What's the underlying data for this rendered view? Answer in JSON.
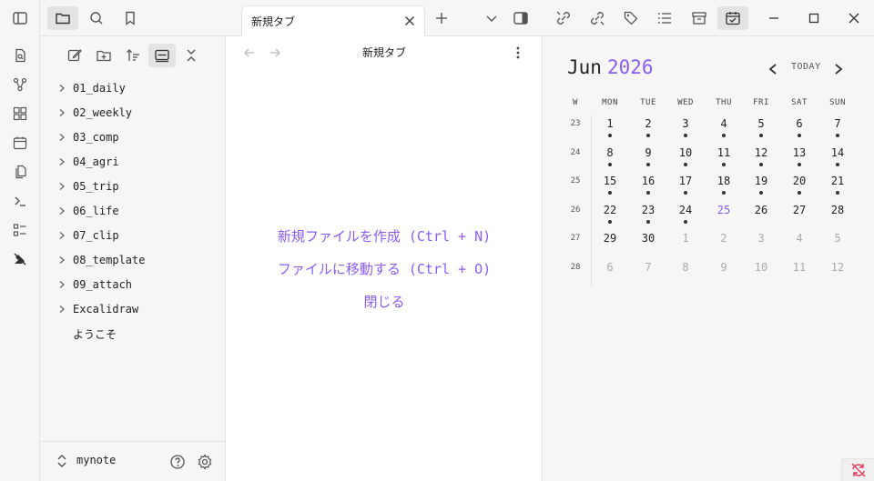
{
  "sidebar": {
    "tree": [
      {
        "label": "01_daily",
        "folder": true
      },
      {
        "label": "02_weekly",
        "folder": true
      },
      {
        "label": "03_comp",
        "folder": true
      },
      {
        "label": "04_agri",
        "folder": true
      },
      {
        "label": "05_trip",
        "folder": true
      },
      {
        "label": "06_life",
        "folder": true
      },
      {
        "label": "07_clip",
        "folder": true
      },
      {
        "label": "08_template",
        "folder": true
      },
      {
        "label": "09_attach",
        "folder": true
      },
      {
        "label": "Excalidraw",
        "folder": true
      },
      {
        "label": "ようこそ",
        "folder": false
      }
    ],
    "vault_name": "mynote"
  },
  "tabs": [
    {
      "label": "新規タブ",
      "active": true
    }
  ],
  "main": {
    "view_title": "新規タブ",
    "actions": {
      "new_file": "新規ファイルを作成 (Ctrl + N)",
      "go_to_file": "ファイルに移動する (Ctrl + O)",
      "close": "閉じる"
    }
  },
  "calendar": {
    "month": "Jun",
    "year": "2026",
    "today_label": "TODAY",
    "week_header": "W",
    "weekdays": [
      "MON",
      "TUE",
      "WED",
      "THU",
      "FRI",
      "SAT",
      "SUN"
    ],
    "weeks": [
      {
        "num": "23",
        "days": [
          {
            "d": "1",
            "dot": true
          },
          {
            "d": "2",
            "dot": true
          },
          {
            "d": "3",
            "dot": true
          },
          {
            "d": "4",
            "dot": true
          },
          {
            "d": "5",
            "dot": true
          },
          {
            "d": "6",
            "dot": true
          },
          {
            "d": "7",
            "dot": true
          }
        ]
      },
      {
        "num": "24",
        "days": [
          {
            "d": "8",
            "dot": true
          },
          {
            "d": "9",
            "dot": true
          },
          {
            "d": "10",
            "dot": true
          },
          {
            "d": "11",
            "dot": true
          },
          {
            "d": "12",
            "dot": true
          },
          {
            "d": "13",
            "dot": true
          },
          {
            "d": "14",
            "dot": true
          }
        ]
      },
      {
        "num": "25",
        "days": [
          {
            "d": "15",
            "dot": true
          },
          {
            "d": "16",
            "dot": true
          },
          {
            "d": "17",
            "dot": true
          },
          {
            "d": "18",
            "dot": true
          },
          {
            "d": "19",
            "dot": true
          },
          {
            "d": "20",
            "dot": true
          },
          {
            "d": "21",
            "dot": true
          }
        ]
      },
      {
        "num": "26",
        "days": [
          {
            "d": "22",
            "dot": true
          },
          {
            "d": "23",
            "dot": true
          },
          {
            "d": "24",
            "dot": true
          },
          {
            "d": "25",
            "today": true
          },
          {
            "d": "26"
          },
          {
            "d": "27"
          },
          {
            "d": "28"
          }
        ]
      },
      {
        "num": "27",
        "days": [
          {
            "d": "29"
          },
          {
            "d": "30"
          },
          {
            "d": "1",
            "other": true
          },
          {
            "d": "2",
            "other": true
          },
          {
            "d": "3",
            "other": true
          },
          {
            "d": "4",
            "other": true
          },
          {
            "d": "5",
            "other": true
          }
        ]
      },
      {
        "num": "28",
        "days": [
          {
            "d": "6",
            "other": true
          },
          {
            "d": "7",
            "other": true
          },
          {
            "d": "8",
            "other": true
          },
          {
            "d": "9",
            "other": true
          },
          {
            "d": "10",
            "other": true
          },
          {
            "d": "11",
            "other": true
          },
          {
            "d": "12",
            "other": true
          }
        ]
      }
    ]
  },
  "colors": {
    "accent": "#8a5cf5",
    "panel_bg": "#f6f6f6",
    "active_btn_bg": "#e3e3e3",
    "sync_status": "#e03a5a"
  },
  "icons": {
    "ribbon": [
      "open-quick-switcher-icon",
      "graph-view-icon",
      "canvas-icon",
      "daily-note-icon",
      "templates-icon",
      "command-palette-icon",
      "excalidraw-icon",
      "sync-icon"
    ]
  }
}
